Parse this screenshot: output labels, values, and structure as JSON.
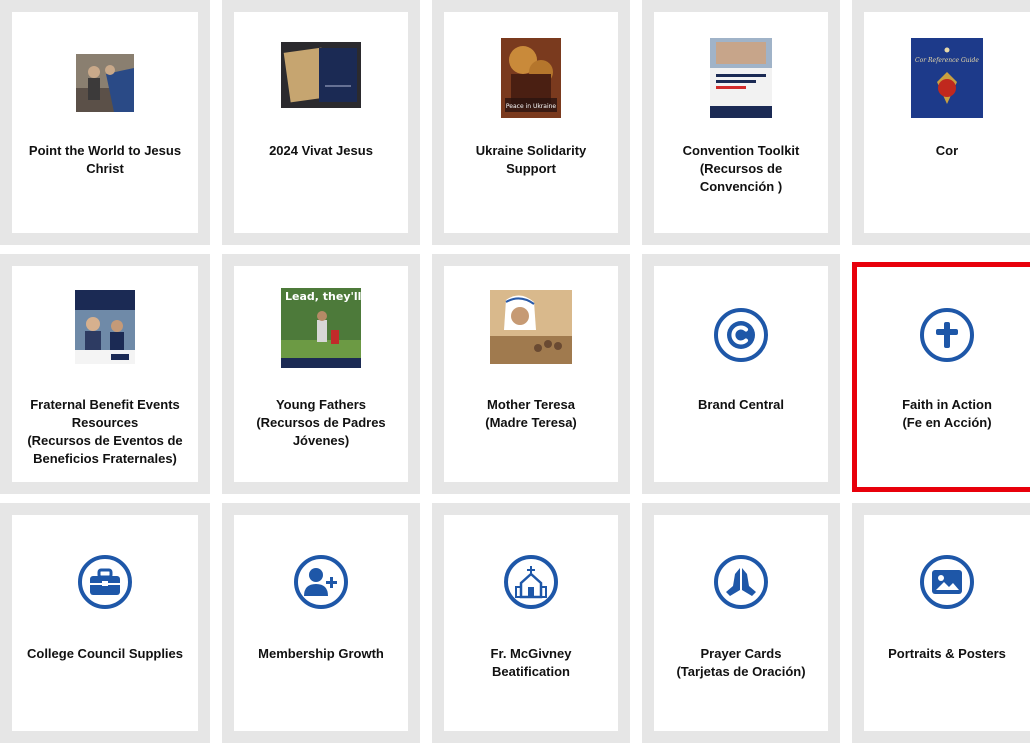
{
  "colors": {
    "brand_blue": "#1e57a8",
    "highlight_red": "#e8000b",
    "tile_border": "#e6e6e6"
  },
  "tiles": [
    {
      "label": "Point the World to Jesus Christ"
    },
    {
      "label": "2024 Vivat Jesus"
    },
    {
      "label": "Ukraine Solidarity Support",
      "thumb_text": "Peace in Ukraine"
    },
    {
      "label": "Convention Toolkit",
      "label2": "(Recursos de Convención )"
    },
    {
      "label": "Cor",
      "thumb_text": "Cor Reference Guide"
    },
    {
      "label": "Fraternal Benefit Events Resources",
      "label2": "(Recursos de Eventos de Beneficios Fraternales)"
    },
    {
      "label": "Young Fathers",
      "label2": "(Recursos de Padres Jóvenes)",
      "thumb_text": "Lead, they'll follow."
    },
    {
      "label": "Mother Teresa",
      "label2": "(Madre Teresa)"
    },
    {
      "label": "Brand Central",
      "icon": "copyright-c-icon"
    },
    {
      "label": "Faith in Action",
      "label2": "(Fe en Acción)",
      "icon": "cross-icon"
    },
    {
      "label": "College Council Supplies",
      "icon": "briefcase-icon"
    },
    {
      "label": "Membership Growth",
      "icon": "add-person-icon"
    },
    {
      "label": "Fr. McGivney Beatification",
      "icon": "church-icon"
    },
    {
      "label": "Prayer Cards",
      "label2": "(Tarjetas de Oración)",
      "icon": "praying-hands-icon"
    },
    {
      "label": "Portraits & Posters",
      "icon": "image-icon"
    }
  ]
}
